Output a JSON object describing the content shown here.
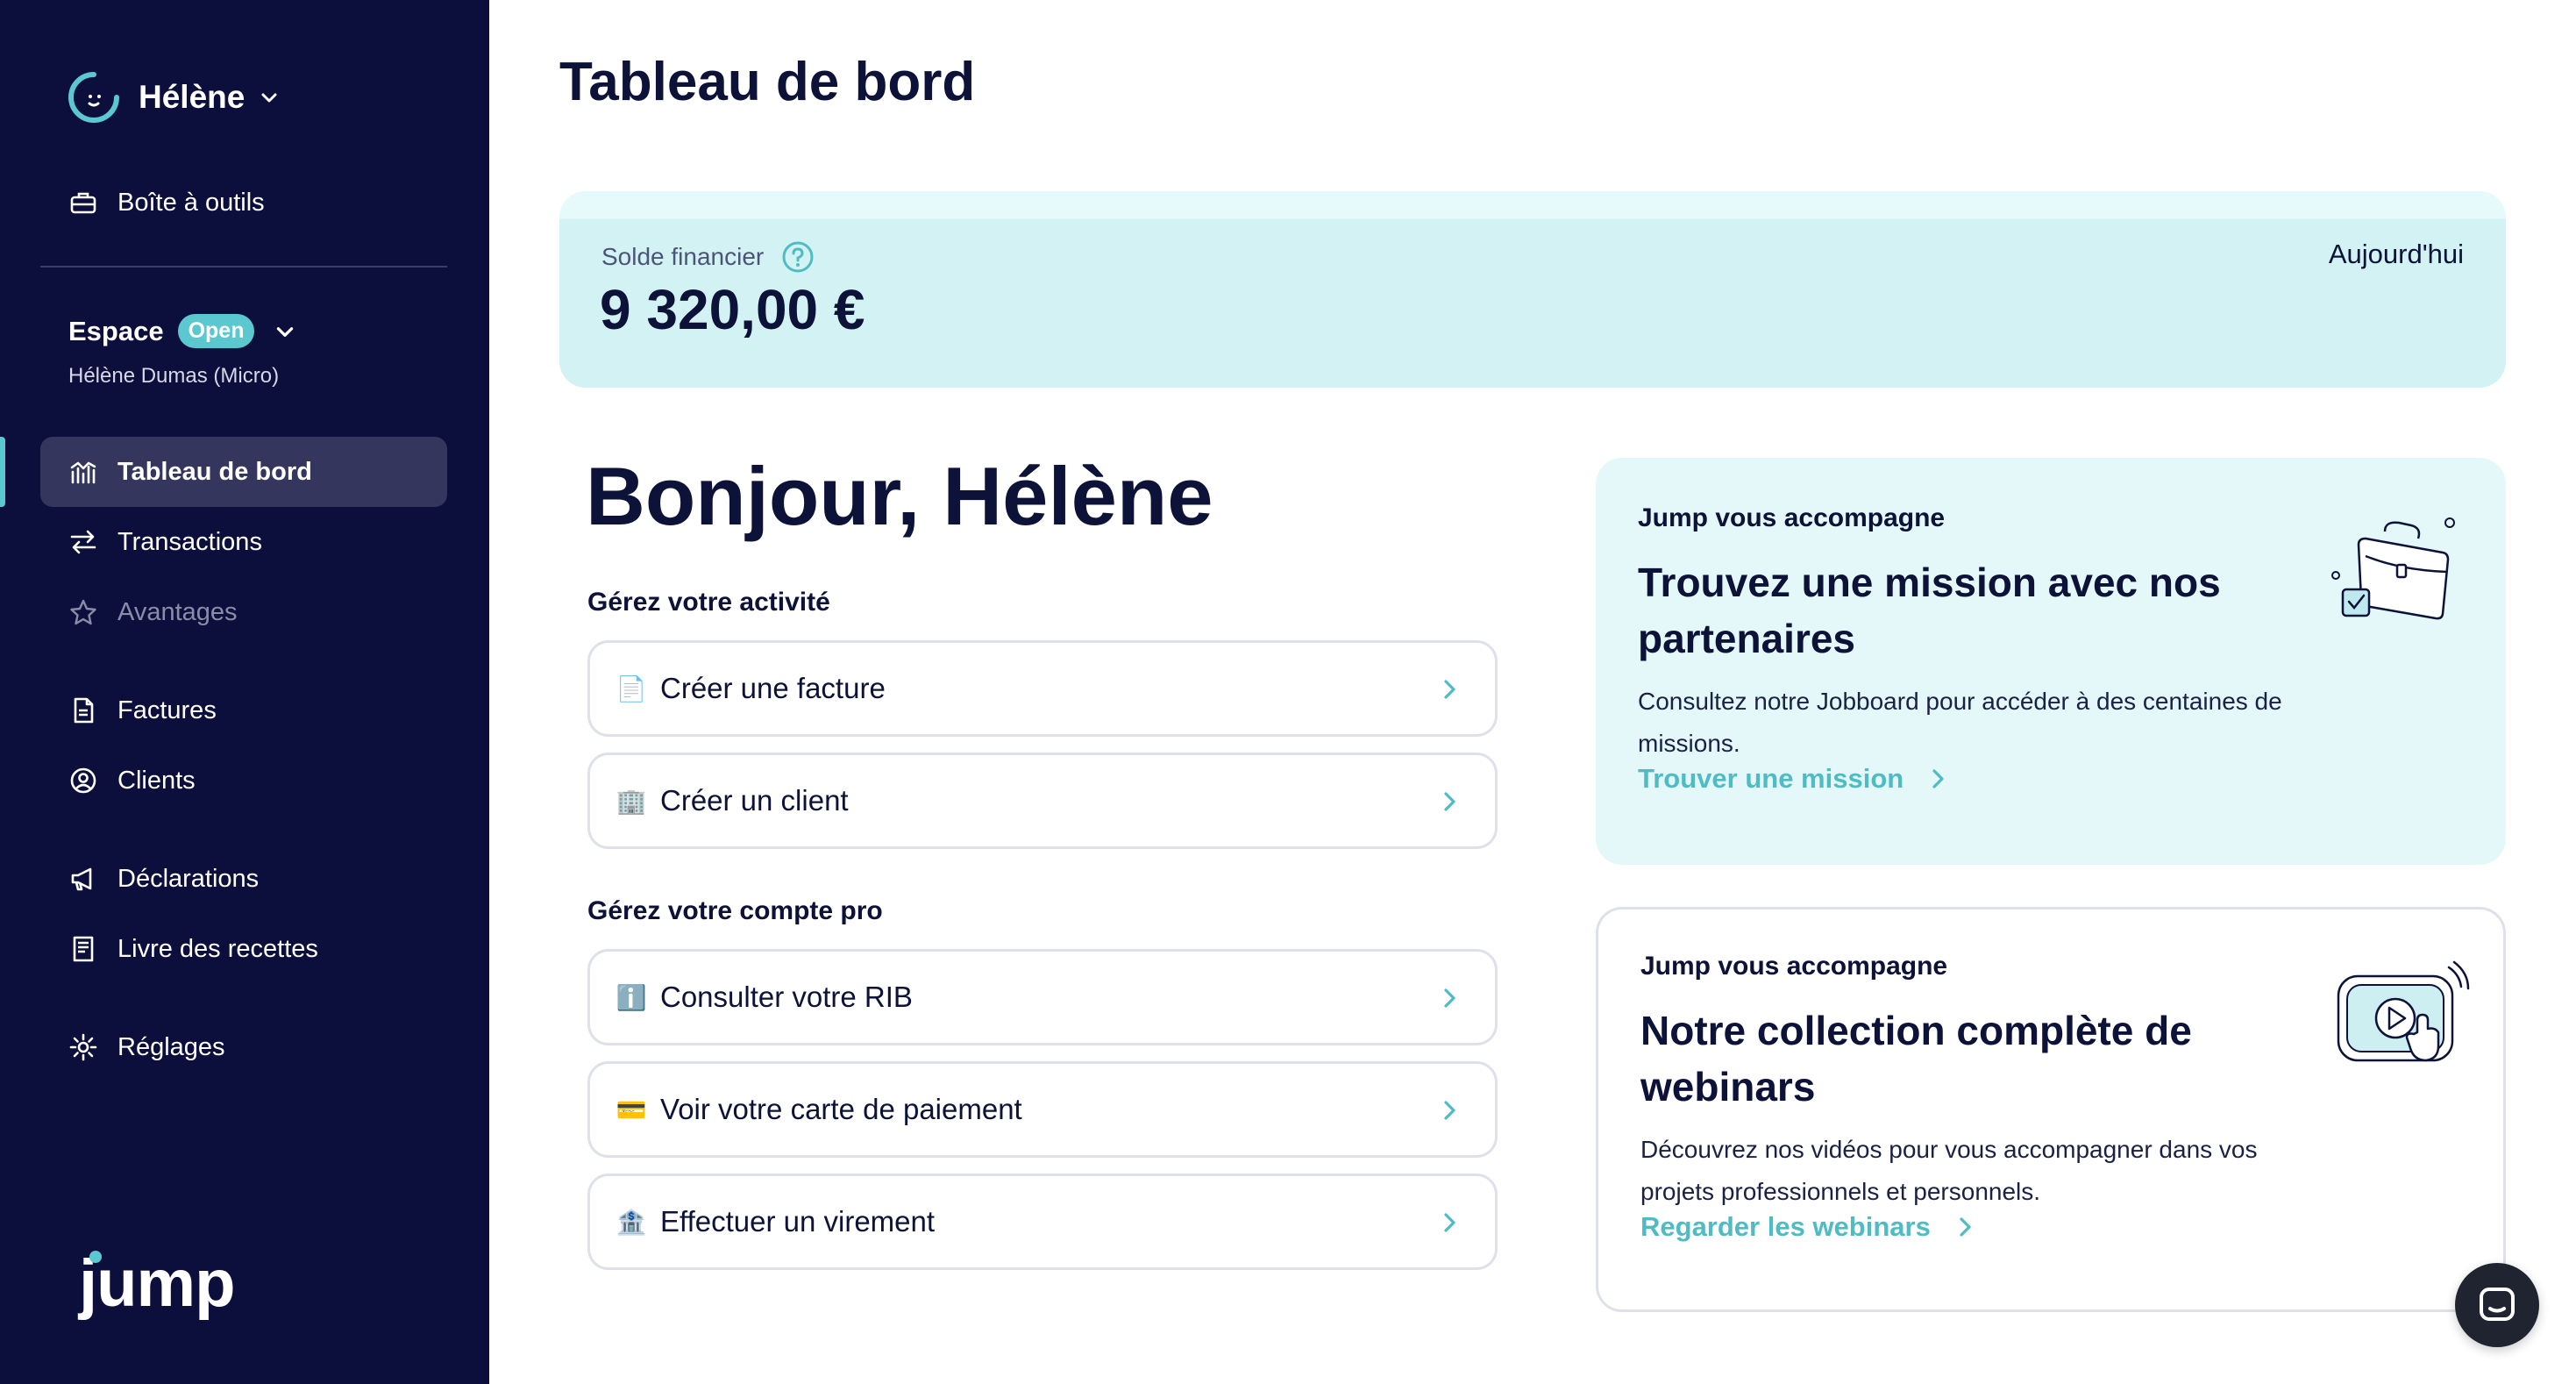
{
  "sidebar": {
    "user_name": "Hélène",
    "toolbox_label": "Boîte à outils",
    "space": {
      "title": "Espace",
      "badge": "Open",
      "subtitle": "Hélène Dumas (Micro)"
    },
    "nav": [
      {
        "label": "Tableau de bord",
        "icon": "chart-icon",
        "active": true
      },
      {
        "label": "Transactions",
        "icon": "transfer-arrows-icon"
      },
      {
        "label": "Avantages",
        "icon": "star-icon",
        "muted": true
      },
      {
        "label": "Factures",
        "icon": "document-icon"
      },
      {
        "label": "Clients",
        "icon": "user-circle-icon"
      },
      {
        "label": "Déclarations",
        "icon": "megaphone-icon"
      },
      {
        "label": "Livre des recettes",
        "icon": "ledger-icon"
      },
      {
        "label": "Réglages",
        "icon": "gear-icon"
      }
    ],
    "brand": "jump"
  },
  "main": {
    "page_title": "Tableau de bord",
    "balance": {
      "label": "Solde financier",
      "amount": "9 320,00 €",
      "period": "Aujourd'hui"
    },
    "greeting": "Bonjour, Hélène",
    "activity": {
      "title": "Gérez votre activité",
      "actions": [
        {
          "label": "Créer une facture",
          "icon": "page-emoji-icon",
          "glyph": "📄"
        },
        {
          "label": "Créer un client",
          "icon": "building-emoji-icon",
          "glyph": "🏢"
        }
      ]
    },
    "account": {
      "title": "Gérez votre compte pro",
      "actions": [
        {
          "label": "Consulter votre RIB",
          "icon": "info-emoji-icon",
          "glyph": "ℹ️"
        },
        {
          "label": "Voir votre carte de paiement",
          "icon": "credit-card-emoji-icon",
          "glyph": "💳"
        },
        {
          "label": "Effectuer un virement",
          "icon": "bank-emoji-icon",
          "glyph": "🏦"
        }
      ]
    },
    "cards": [
      {
        "eyebrow": "Jump vous accompagne",
        "title": "Trouvez une mission avec nos partenaires",
        "description": "Consultez notre Jobboard pour accéder à des centaines de missions.",
        "link": "Trouver une mission",
        "illustration": "briefcase-icon"
      },
      {
        "eyebrow": "Jump vous accompagne",
        "title": "Notre collection complète de webinars",
        "description": "Découvrez nos vidéos pour vous accompagner dans vos projets professionnels et personnels.",
        "link": "Regarder les webinars",
        "illustration": "video-player-icon"
      }
    ]
  },
  "colors": {
    "sidebar_bg": "#0c0f3c",
    "accent": "#5bc8cf",
    "link": "#4fbcc4",
    "text": "#0c1238",
    "balance_bg": "#d3f2f4",
    "card_bg": "#e4f7f9"
  }
}
